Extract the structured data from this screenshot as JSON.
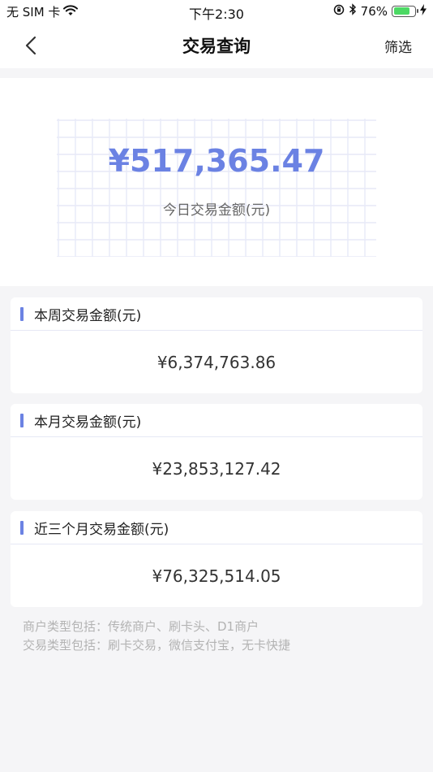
{
  "status_bar": {
    "carrier": "无 SIM 卡",
    "time": "下午2:30",
    "battery_percent": "76%",
    "battery_level": 0.76
  },
  "nav": {
    "title": "交易查询",
    "filter_label": "筛选"
  },
  "today": {
    "amount": "¥517,365.47",
    "label": "今日交易金额(元)"
  },
  "cards": [
    {
      "title": "本周交易金额(元)",
      "value": "¥6,374,763.86"
    },
    {
      "title": "本月交易金额(元)",
      "value": "¥23,853,127.42"
    },
    {
      "title": "近三个月交易金额(元)",
      "value": "¥76,325,514.05"
    }
  ],
  "notes": [
    "商户类型包括：传统商户、刷卡头、D1商户",
    "交易类型包括：刷卡交易，微信支付宝，无卡快捷"
  ],
  "colors": {
    "accent": "#6b82e3",
    "background": "#f5f5f7",
    "battery": "#4cd964"
  }
}
